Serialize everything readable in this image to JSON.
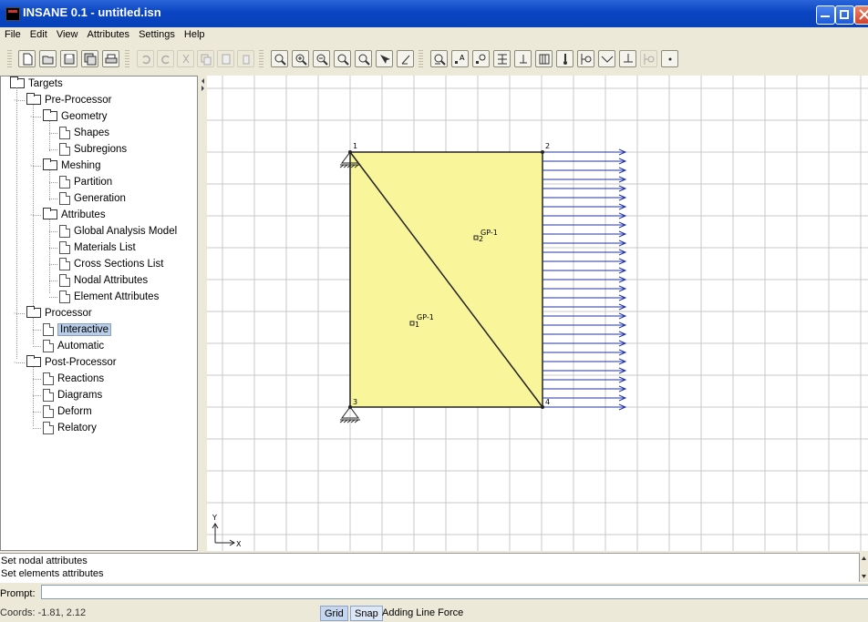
{
  "window": {
    "title": "INSANE 0.1 - untitled.isn"
  },
  "menu": [
    "File",
    "Edit",
    "View",
    "Attributes",
    "Settings",
    "Help"
  ],
  "toolbar": {
    "buttons": [
      "new-file-icon",
      "open-file-icon",
      "save-icon",
      "save-as-icon",
      "print-icon",
      "undo-icon",
      "redo-icon",
      "cut-icon",
      "copy-icon",
      "paste-icon",
      "delete-icon",
      "zoom-icon",
      "zoom-in-icon",
      "zoom-out-icon",
      "zoom-window-icon",
      "zoom-all-icon",
      "pan-icon",
      "fit-icon",
      "find-icon",
      "text-label-icon",
      "node-label-icon",
      "section-icon",
      "support-icon",
      "distributed-load-icon",
      "temperature-icon",
      "hinge-icon",
      "release-icon",
      "point-load-icon",
      "constraint-icon",
      "point-icon"
    ]
  },
  "tree": {
    "root": "Targets",
    "items": [
      {
        "label": "Pre-Processor",
        "type": "folder",
        "level": 1
      },
      {
        "label": "Geometry",
        "type": "folder",
        "level": 2
      },
      {
        "label": "Shapes",
        "type": "doc",
        "level": 3
      },
      {
        "label": "Subregions",
        "type": "doc",
        "level": 3
      },
      {
        "label": "Meshing",
        "type": "folder",
        "level": 2
      },
      {
        "label": "Partition",
        "type": "doc",
        "level": 3
      },
      {
        "label": "Generation",
        "type": "doc",
        "level": 3
      },
      {
        "label": "Attributes",
        "type": "folder",
        "level": 2
      },
      {
        "label": "Global Analysis Model",
        "type": "doc",
        "level": 3
      },
      {
        "label": "Materials List",
        "type": "doc",
        "level": 3
      },
      {
        "label": "Cross Sections List",
        "type": "doc",
        "level": 3
      },
      {
        "label": "Nodal Attributes",
        "type": "doc",
        "level": 3
      },
      {
        "label": "Element Attributes",
        "type": "doc",
        "level": 3
      },
      {
        "label": "Processor",
        "type": "folder",
        "level": 1
      },
      {
        "label": "Interactive",
        "type": "doc",
        "level": 2,
        "selected": true
      },
      {
        "label": "Automatic",
        "type": "doc",
        "level": 2
      },
      {
        "label": "Post-Processor",
        "type": "folder",
        "level": 1
      },
      {
        "label": "Reactions",
        "type": "doc",
        "level": 2
      },
      {
        "label": "Diagrams",
        "type": "doc",
        "level": 2
      },
      {
        "label": "Deform",
        "type": "doc",
        "level": 2
      },
      {
        "label": "Relatory",
        "type": "doc",
        "level": 2
      }
    ]
  },
  "model": {
    "nodes": [
      "1",
      "2",
      "3",
      "4"
    ],
    "elements": [
      "1",
      "2"
    ],
    "gauss_labels": [
      "GP-1",
      "GP-1"
    ],
    "fill_color": "#f9f59a",
    "load_color": "#2233aa",
    "axis": {
      "x": "X",
      "y": "Y"
    }
  },
  "messages": [
    "Set nodal attributes",
    "Set elements attributes"
  ],
  "prompt": {
    "label": "Prompt:",
    "value": ""
  },
  "status": {
    "coords": "Coords: -1.81, 2.12",
    "grid": "Grid",
    "snap": "Snap",
    "text": "Adding Line Force"
  }
}
